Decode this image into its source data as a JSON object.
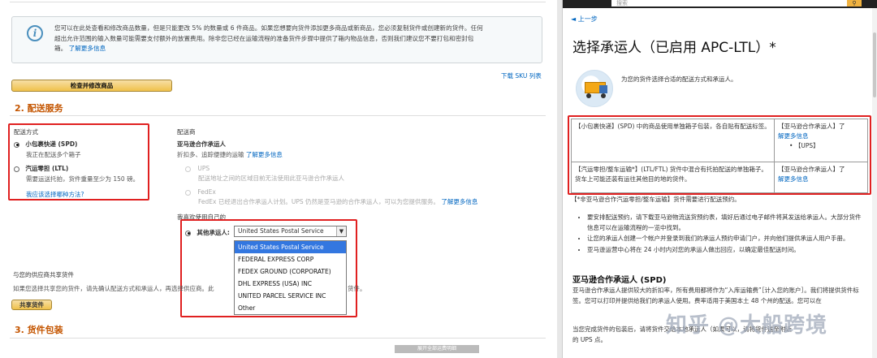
{
  "left": {
    "info_text_1": "您可以在此处查看和修改商品数量，但是只能更改 5% 的数量或 6 件商品。如果您想要向货件添加更多商品或新商品，您必须复制货件或创建新的货件。任何",
    "info_text_2": "超出允许范围的输入数量可能需要支付额外的放置费用。除非您已经在运输流程的准备货件步骤中提供了箱内物品信息，否则我们建议您不要打包和密封包",
    "info_text_3": "箱。",
    "info_link": "了解更多信息",
    "check_button": "检查并修改商品",
    "sku_link": "下载 SKU 列表",
    "section2_title": "2. 配送服务",
    "shipping_method_label": "配送方式",
    "spd_title": "小包裹快递 (SPD)",
    "spd_desc": "我正在配送多个箱子",
    "ltl_title": "汽运零担 (LTL)",
    "ltl_desc": "需要运送托拍，货件重量至少为 150 磅。",
    "how_choose_link": "我应该选择哪种方法?",
    "carrier_label": "配送商",
    "amazon_partner_title": "亚马逊合作承运人",
    "amazon_partner_desc": "折扣多、追踪便捷的运输",
    "amazon_partner_link": "了解更多信息",
    "ups_title": "UPS",
    "ups_desc": "配送地址之间的区域目前无法使用此亚马逊合作承运人",
    "fedex_title": "FedEx",
    "fedex_desc": "FedEx 已经退出合作承运人计划。UPS 仍然是亚马逊的合作承运人，可以为您提供服务。",
    "fedex_link": "了解更多信息",
    "own_carrier_label": "我喜欢使用自己的",
    "other_carrier_label": "其他承运人:",
    "carrier_selected": "United States Postal Service",
    "carrier_options": [
      "United States Postal Service",
      "FEDERAL EXPRESS CORP",
      "FEDEX GROUND (CORPORATE)",
      "DHL EXPRESS (USA) INC",
      "UNITED PARCEL SERVICE INC",
      "Other"
    ],
    "share_section_title": "与您的供应商共享货件",
    "share_desc": "如果您选择共享您的货件，请先确认配送方式和承运人，再选择供应商。此",
    "share_desc_tail": "货件。",
    "share_button": "共享货件",
    "section3_title": "3. 货件包装",
    "bottom_bar": "展开全部运费明细"
  },
  "right": {
    "search_placeholder": "搜索",
    "back_link": "上一步",
    "title": "选择承运人（已启用 APC-LTL）*",
    "subtitle": "为您的货件选择合适的配送方式和承运人。",
    "table_row1_left": "【小包裹快递】(SPD) 中的商品使用单独箱子包装，各自贴有配送标签。",
    "table_row1_right_a": "【亚马逊合作承运人】了",
    "table_row1_right_b": "解更多信息",
    "table_row1_bullet": "【UPS】",
    "table_row2_left": "【汽运零担/整车运输*】(LTL/FTL) 货件中混合有托拍配送的单独箱子。货车上可能还装有运往其他目的地的货件。",
    "table_row2_right_a": "【亚马逊合作承运人】了",
    "table_row2_right_b": "解更多信息",
    "note": "【*非亚马逊合作汽运零担/整车运输】货件需要进行配送预约。",
    "bullets": [
      "要安排配送预约，请下载亚马逊物流送货预约表，填好后通过电子邮件将其发送给承运人。大部分货件信息可以在运输流程的一览中找到。",
      "让您的承运人创建一个帐户并登录到我们的承运人预约申请门户，并向他们提供承运人用户手册。",
      "亚马逊运营中心将在 24 小时内对您的承运人做出回应，以确定最佳配送时间。"
    ],
    "section_title": "亚马逊合作承运人 (SPD)",
    "para1": "亚马逊合作承运人提供较大的折扣率，所有费用都将作为“入库运输费”［计入您的账户］。我们将提供货件标签。您可以打印并提供给我们的承运人使用。费率适用于美国本土 48 个州的配送。您可以在",
    "para2": "当您完成货件的包装后，请将货件交给本地承运人（如果可以，请将货件送至附近",
    "para2b": "的 UPS 点。",
    "watermark": "知乎 @大船跨境"
  }
}
